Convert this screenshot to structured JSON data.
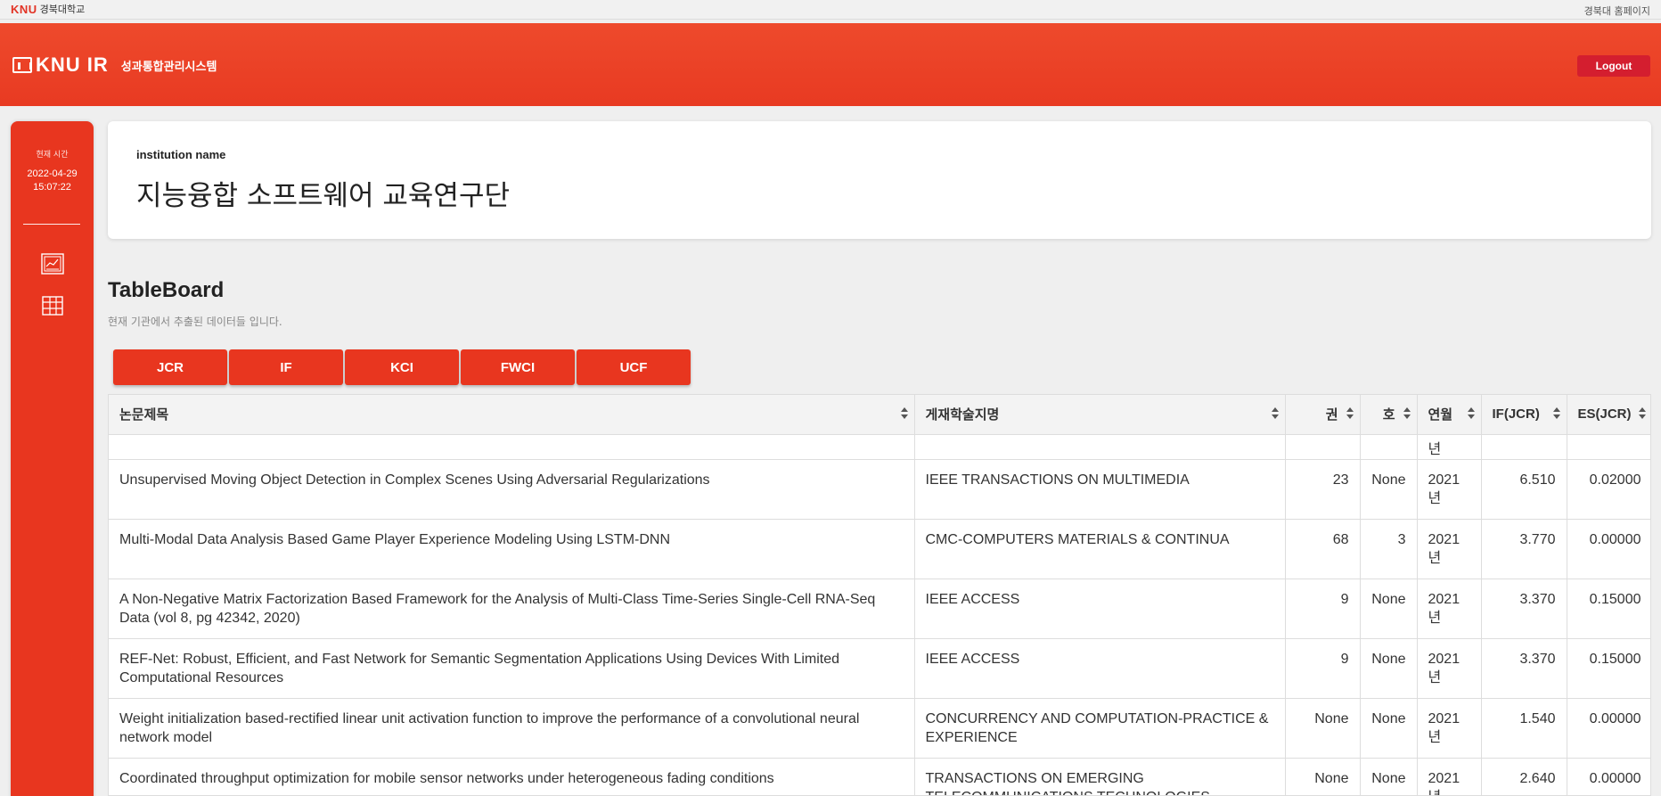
{
  "topbar": {
    "brand_logo": "KNU",
    "brand_name": "경북대학교",
    "home_link": "경북대 홈페이지"
  },
  "header": {
    "logo_text": "KNU IR",
    "system_name": "성과통합관리시스템",
    "logout_label": "Logout"
  },
  "sidebar": {
    "time_label": "현재 시간",
    "date": "2022-04-29",
    "time": "15:07:22",
    "icons": [
      "chart-icon",
      "table-icon"
    ]
  },
  "institution": {
    "label": "institution name",
    "name": "지능융합 소프트웨어 교육연구단"
  },
  "tableboard": {
    "title": "TableBoard",
    "subtitle": "현재 기관에서 추출된 데이터들 입니다.",
    "tabs": [
      "JCR",
      "IF",
      "KCI",
      "FWCI",
      "UCF"
    ],
    "columns": [
      "논문제목",
      "게재학술지명",
      "권",
      "호",
      "연월",
      "IF(JCR)",
      "ES(JCR)"
    ],
    "partial_row": {
      "ym": "년"
    },
    "rows": [
      {
        "title": "Unsupervised Moving Object Detection in Complex Scenes Using Adversarial Regularizations",
        "journal": "IEEE TRANSACTIONS ON MULTIMEDIA",
        "vol": "23",
        "no": "None",
        "year": "2021",
        "year_suffix": "년",
        "if": "6.510",
        "es": "0.02000"
      },
      {
        "title": "Multi-Modal Data Analysis Based Game Player Experience Modeling Using LSTM-DNN",
        "journal": "CMC-COMPUTERS MATERIALS & CONTINUA",
        "vol": "68",
        "no": "3",
        "year": "2021",
        "year_suffix": "년",
        "if": "3.770",
        "es": "0.00000"
      },
      {
        "title": "A Non-Negative Matrix Factorization Based Framework for the Analysis of Multi-Class Time-Series Single-Cell RNA-Seq Data (vol 8, pg 42342, 2020)",
        "journal": "IEEE ACCESS",
        "vol": "9",
        "no": "None",
        "year": "2021",
        "year_suffix": "년",
        "if": "3.370",
        "es": "0.15000"
      },
      {
        "title": "REF-Net: Robust, Efficient, and Fast Network for Semantic Segmentation Applications Using Devices With Limited Computational Resources",
        "journal": "IEEE ACCESS",
        "vol": "9",
        "no": "None",
        "year": "2021",
        "year_suffix": "년",
        "if": "3.370",
        "es": "0.15000"
      },
      {
        "title": "Weight initialization based-rectified linear unit activation function to improve the performance of a convolutional neural network model",
        "journal": "CONCURRENCY AND COMPUTATION-PRACTICE & EXPERIENCE",
        "vol": "None",
        "no": "None",
        "year": "2021",
        "year_suffix": "년",
        "if": "1.540",
        "es": "0.00000"
      },
      {
        "title": "Coordinated throughput optimization for mobile sensor networks under heterogeneous fading conditions",
        "journal": "TRANSACTIONS ON EMERGING TELECOMMUNICATIONS TECHNOLOGIES",
        "vol": "None",
        "no": "None",
        "year": "2021",
        "year_suffix": "년",
        "if": "2.640",
        "es": "0.00000"
      }
    ]
  }
}
